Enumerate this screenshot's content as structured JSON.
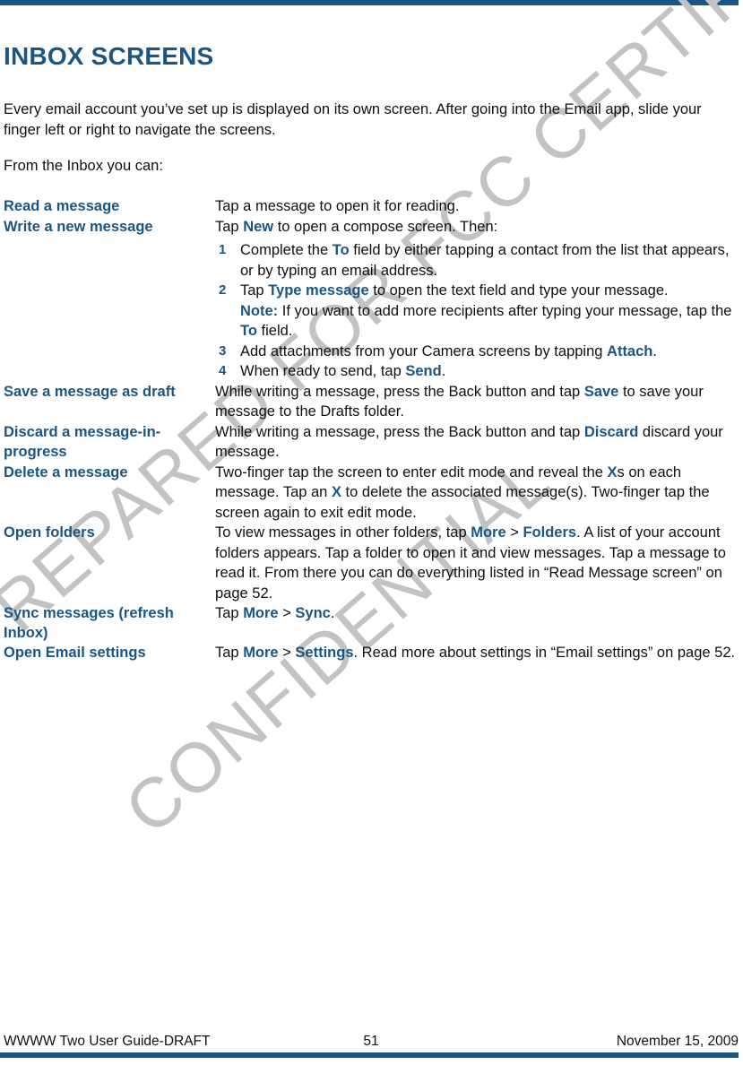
{
  "theme": {
    "accent_blue": "#1b5584",
    "body_text": "#101010",
    "watermark_gray": "#c3c3c3"
  },
  "page": {
    "title": "INBOX SCREENS",
    "intro_paragraph_1": "Every email account you’ve set up is displayed on its own screen. After going into the Email app, slide your finger left or right to navigate the screens.",
    "intro_paragraph_2": "From the Inbox you can:"
  },
  "watermark": {
    "line_1": "PREPARED FOR FCC CERTIFICATION",
    "line_2": "CONFIDENTIAL"
  },
  "rows": {
    "read": {
      "term": "Read a message",
      "desc": "Tap a message to open it for reading."
    },
    "write": {
      "term": "Write a new message",
      "lead_pre": "Tap ",
      "lead_hl": "New",
      "lead_post": " to open a compose screen. Then:",
      "steps": [
        {
          "num": "1",
          "pre": "Complete the ",
          "hl": "To",
          "post": " field by either tapping a contact from the list that appears, or by typing an email address."
        },
        {
          "num": "2",
          "pre": "Tap ",
          "hl": "Type message",
          "post": " to open the text field and type your message.",
          "note_label": "Note:",
          "note_pre": " If you want to add more recipients after typing your message, tap the ",
          "note_hl": "To",
          "note_post": " field."
        },
        {
          "num": "3",
          "pre": "Add attachments from your Camera screens by tapping ",
          "hl": "Attach",
          "post": "."
        },
        {
          "num": "4",
          "pre": "When ready to send, tap ",
          "hl": "Send",
          "post": "."
        }
      ]
    },
    "save_draft": {
      "term": "Save a message as draft",
      "pre": "While writing a message, press the Back button and tap ",
      "hl": "Save",
      "post": " to save your message to the Drafts folder."
    },
    "discard": {
      "term": "Discard a message-in-progress",
      "pre": "While writing a message, press the Back button and tap ",
      "hl": "Discard",
      "post": " discard your message."
    },
    "delete": {
      "term": "Delete a message",
      "part_1": "Two-finger tap the screen to enter edit mode and reveal the ",
      "hl_1": "X",
      "part_2": "s on each message. Tap an ",
      "hl_2": "X",
      "part_3": " to delete the associated message(s). Two-finger tap the screen again to exit edit mode."
    },
    "open_folders": {
      "term": "Open folders",
      "pre": "To view messages in other folders, tap ",
      "hl_1": "More",
      "sep": " > ",
      "hl_2": "Folders",
      "post": ". A list of your account folders appears. Tap a folder to open it and view messages. Tap a message to read it. From there you can do everything listed in “Read Message screen” on page 52."
    },
    "sync": {
      "term": "Sync messages (refresh Inbox)",
      "pre": "Tap ",
      "hl_1": "More",
      "sep": " > ",
      "hl_2": "Sync",
      "post": "."
    },
    "settings": {
      "term": "Open Email settings",
      "pre": "Tap ",
      "hl_1": "More",
      "sep": " > ",
      "hl_2": "Settings",
      "post": ". Read more about settings in “Email settings” on page 52."
    }
  },
  "footer": {
    "left": "WWWW Two User Guide-DRAFT",
    "page_number": "51",
    "right": "November 15, 2009"
  }
}
